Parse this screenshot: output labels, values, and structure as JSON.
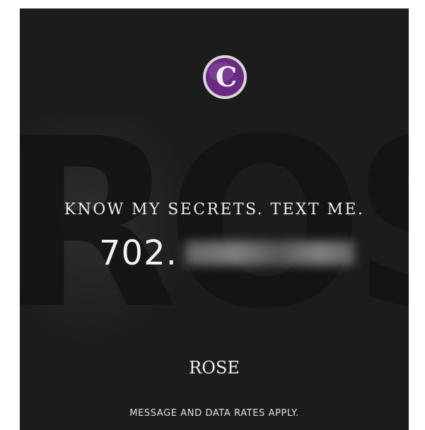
{
  "logo": {
    "letter": "C",
    "icon": "brand-c-logo-icon"
  },
  "background_word": "ROSE",
  "tagline": "KNOW MY SECRETS. TEXT ME.",
  "phone": {
    "prefix": "702."
  },
  "name": "ROSE",
  "disclaimer": "MESSAGE AND DATA RATES APPLY.",
  "colors": {
    "background": "#1c1c1c",
    "logo_purple": "#6b2a82",
    "text": "#ececec"
  }
}
